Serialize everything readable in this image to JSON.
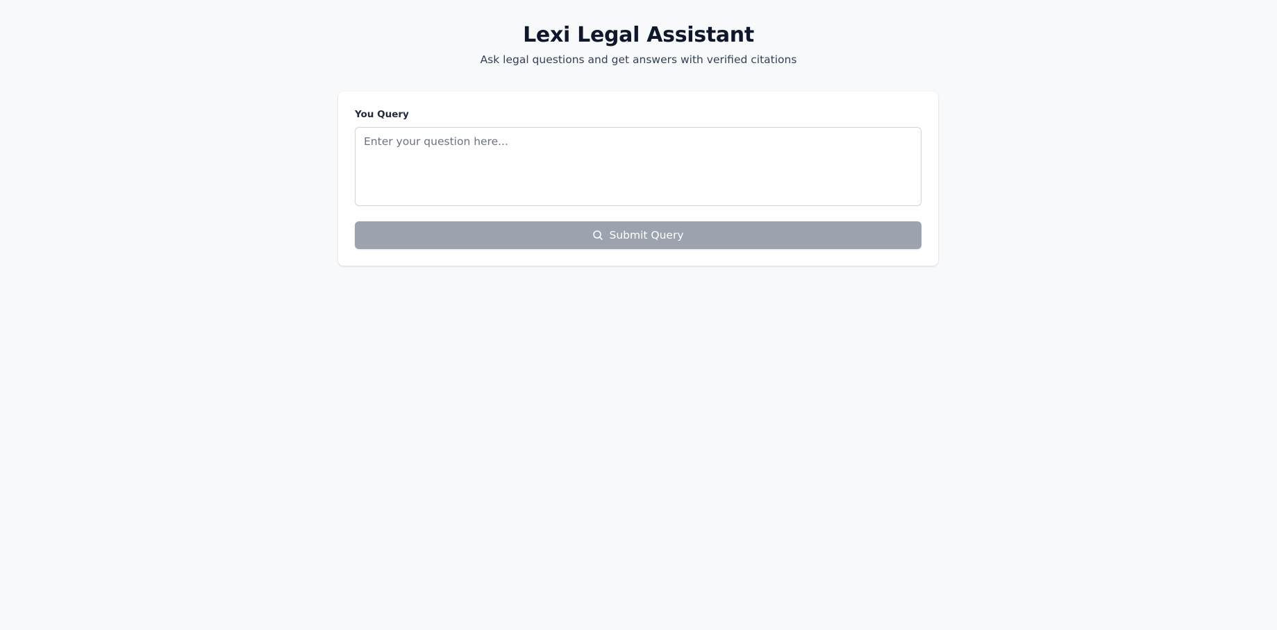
{
  "header": {
    "title": "Lexi Legal Assistant",
    "subtitle": "Ask legal questions and get answers with verified citations"
  },
  "query_form": {
    "label": "You Query",
    "input_value": "",
    "placeholder": "Enter your question here...",
    "submit_label": "Submit Query",
    "submit_icon": "search-icon",
    "submit_disabled": true
  },
  "colors": {
    "page_background": "#f8f9fb",
    "card_background": "#ffffff",
    "title": "#0f172a",
    "button_disabled": "#9ca3af",
    "button_text": "#ffffff"
  }
}
